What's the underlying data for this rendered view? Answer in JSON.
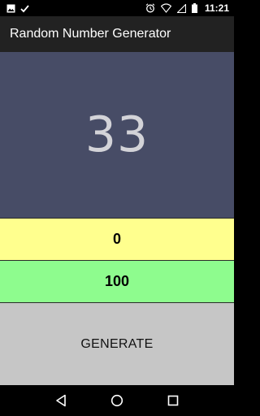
{
  "status_bar": {
    "time": "11:21",
    "icons": [
      "image-icon",
      "check-icon",
      "alarm-icon",
      "wifi-off-icon",
      "signal-icon",
      "battery-icon"
    ]
  },
  "app_bar": {
    "title": "Random Number Generator"
  },
  "display": {
    "result": "33"
  },
  "range": {
    "min_value": "0",
    "max_value": "100"
  },
  "actions": {
    "generate_label": "GENERATE"
  },
  "nav_bar": {
    "icons": [
      "back-icon",
      "home-icon",
      "recents-icon"
    ]
  },
  "colors": {
    "display_bg": "#474c66",
    "min_bg": "#ffff8e",
    "max_bg": "#8efc8e",
    "button_bg": "#c6c6c6",
    "app_bar_bg": "#222222"
  }
}
